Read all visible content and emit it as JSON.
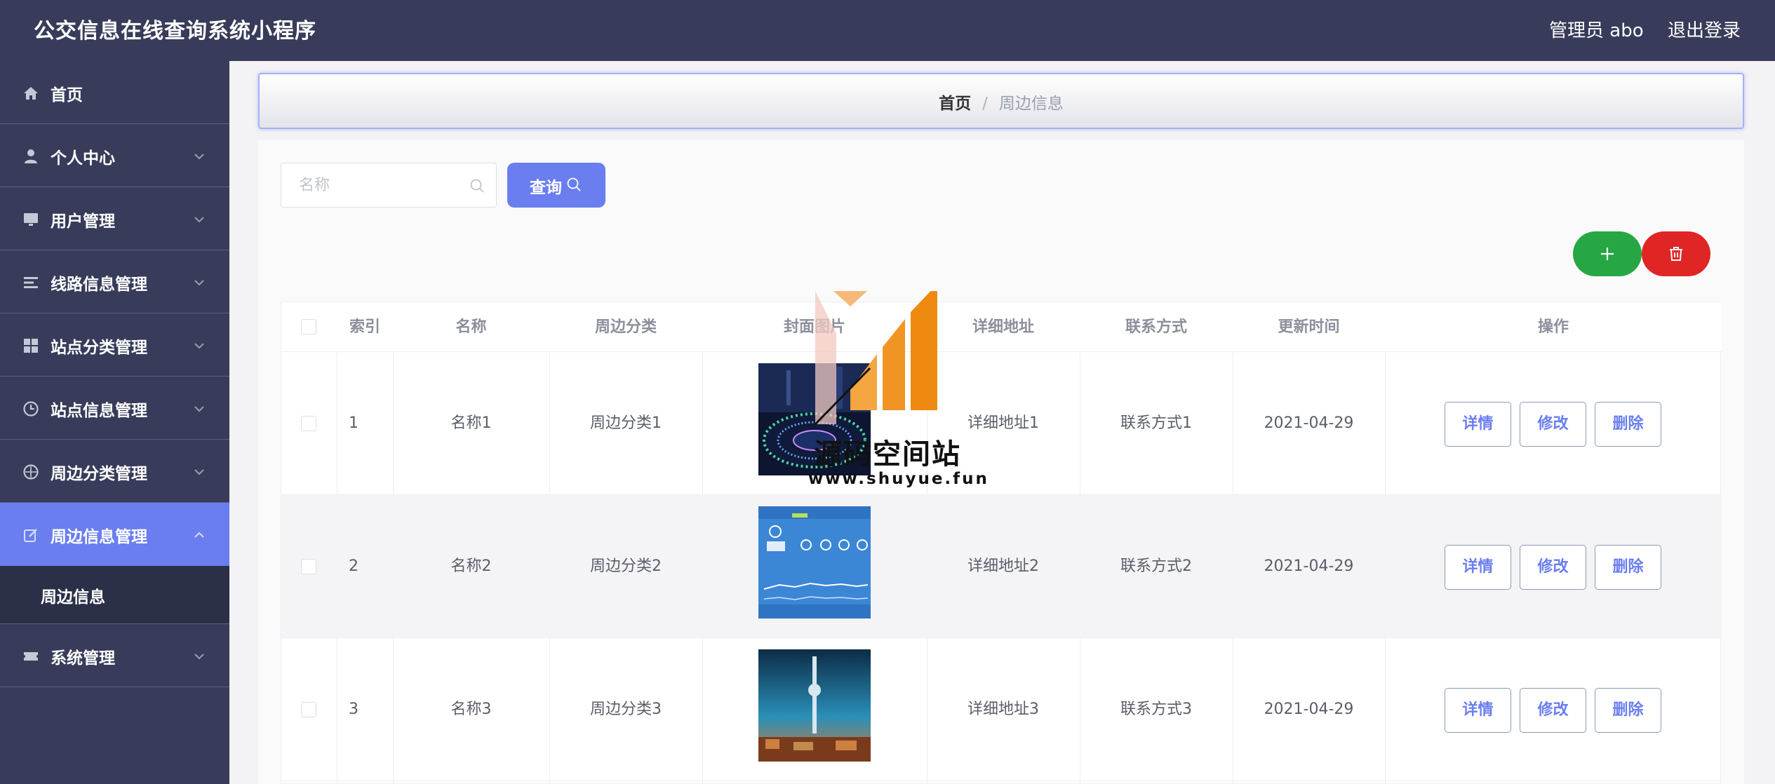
{
  "header": {
    "app_title": "公交信息在线查询系统小程序",
    "user_label": "管理员 abo",
    "logout_label": "退出登录"
  },
  "sidebar": {
    "items": [
      {
        "label": "首页",
        "icon": "home-icon",
        "expandable": false
      },
      {
        "label": "个人中心",
        "icon": "user-icon",
        "expandable": true
      },
      {
        "label": "用户管理",
        "icon": "monitor-icon",
        "expandable": true
      },
      {
        "label": "线路信息管理",
        "icon": "list-icon",
        "expandable": true
      },
      {
        "label": "站点分类管理",
        "icon": "grid-icon",
        "expandable": true
      },
      {
        "label": "站点信息管理",
        "icon": "clock-icon",
        "expandable": true
      },
      {
        "label": "周边分类管理",
        "icon": "compass-icon",
        "expandable": true
      },
      {
        "label": "周边信息管理",
        "icon": "edit-icon",
        "expandable": true,
        "active": true
      },
      {
        "label": "系统管理",
        "icon": "ticket-icon",
        "expandable": true
      }
    ],
    "submenu": {
      "label": "周边信息"
    }
  },
  "breadcrumb": {
    "home": "首页",
    "separator": "/",
    "current": "周边信息"
  },
  "search": {
    "placeholder": "名称",
    "value": "",
    "button_label": "查询"
  },
  "table": {
    "columns": [
      "索引",
      "名称",
      "周边分类",
      "封面图片",
      "详细地址",
      "联系方式",
      "更新时间",
      "操作"
    ],
    "rows": [
      {
        "index": "1",
        "name": "名称1",
        "category": "周边分类1",
        "cover": "fountain-night-photo",
        "address": "详细地址1",
        "contact": "联系方式1",
        "updated": "2021-04-29"
      },
      {
        "index": "2",
        "name": "名称2",
        "category": "周边分类2",
        "cover": "weather-forecast-screenshot",
        "address": "详细地址2",
        "contact": "联系方式2",
        "updated": "2021-04-29"
      },
      {
        "index": "3",
        "name": "名称3",
        "category": "周边分类3",
        "cover": "berlin-tv-tower-photo",
        "address": "详细地址3",
        "contact": "联系方式3",
        "updated": "2021-04-29"
      }
    ],
    "actions": {
      "detail": "详情",
      "edit": "修改",
      "delete": "删除"
    }
  },
  "watermark": {
    "text": "源码空间站",
    "url": "www.shuyue.fun"
  },
  "colors": {
    "topbar": "#383c5a",
    "accent": "#6a7ef0",
    "add": "#27a744",
    "delete": "#e02525"
  }
}
